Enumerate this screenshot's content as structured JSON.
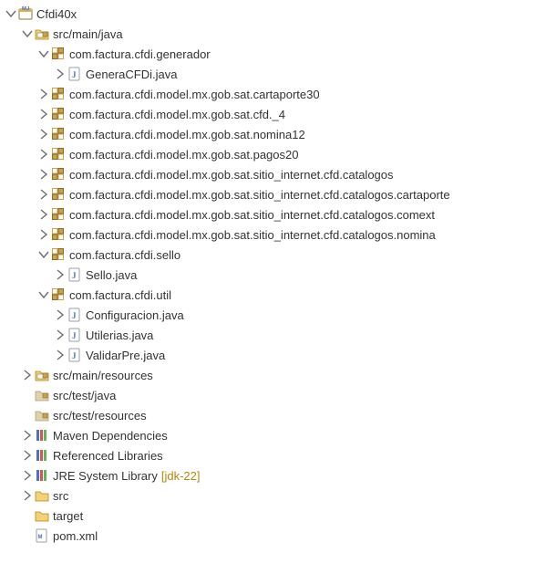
{
  "project": {
    "name": "Cfdi40x"
  },
  "srcMainJava": "src/main/java",
  "srcMainResources": "src/main/resources",
  "srcTestJava": "src/test/java",
  "srcTestResources": "src/test/resources",
  "pkg_generador": "com.factura.cfdi.generador",
  "file_generacfdi": "GeneraCFDi.java",
  "pkg_cartaporte30": "com.factura.cfdi.model.mx.gob.sat.cartaporte30",
  "pkg_cfd4": "com.factura.cfdi.model.mx.gob.sat.cfd._4",
  "pkg_nomina12": "com.factura.cfdi.model.mx.gob.sat.nomina12",
  "pkg_pagos20": "com.factura.cfdi.model.mx.gob.sat.pagos20",
  "pkg_catalogos": "com.factura.cfdi.model.mx.gob.sat.sitio_internet.cfd.catalogos",
  "pkg_catalogos_cartaporte": "com.factura.cfdi.model.mx.gob.sat.sitio_internet.cfd.catalogos.cartaporte",
  "pkg_catalogos_comext": "com.factura.cfdi.model.mx.gob.sat.sitio_internet.cfd.catalogos.comext",
  "pkg_catalogos_nomina": "com.factura.cfdi.model.mx.gob.sat.sitio_internet.cfd.catalogos.nomina",
  "pkg_sello": "com.factura.cfdi.sello",
  "file_sello": "Sello.java",
  "pkg_util": "com.factura.cfdi.util",
  "file_configuracion": "Configuracion.java",
  "file_utilerias": "Utilerias.java",
  "file_validarpre": "ValidarPre.java",
  "maven_deps": "Maven Dependencies",
  "ref_libs": "Referenced Libraries",
  "jre_lib": "JRE System Library",
  "jre_decorator": "[jdk-22]",
  "folder_src": "src",
  "folder_target": "target",
  "file_pom": "pom.xml"
}
